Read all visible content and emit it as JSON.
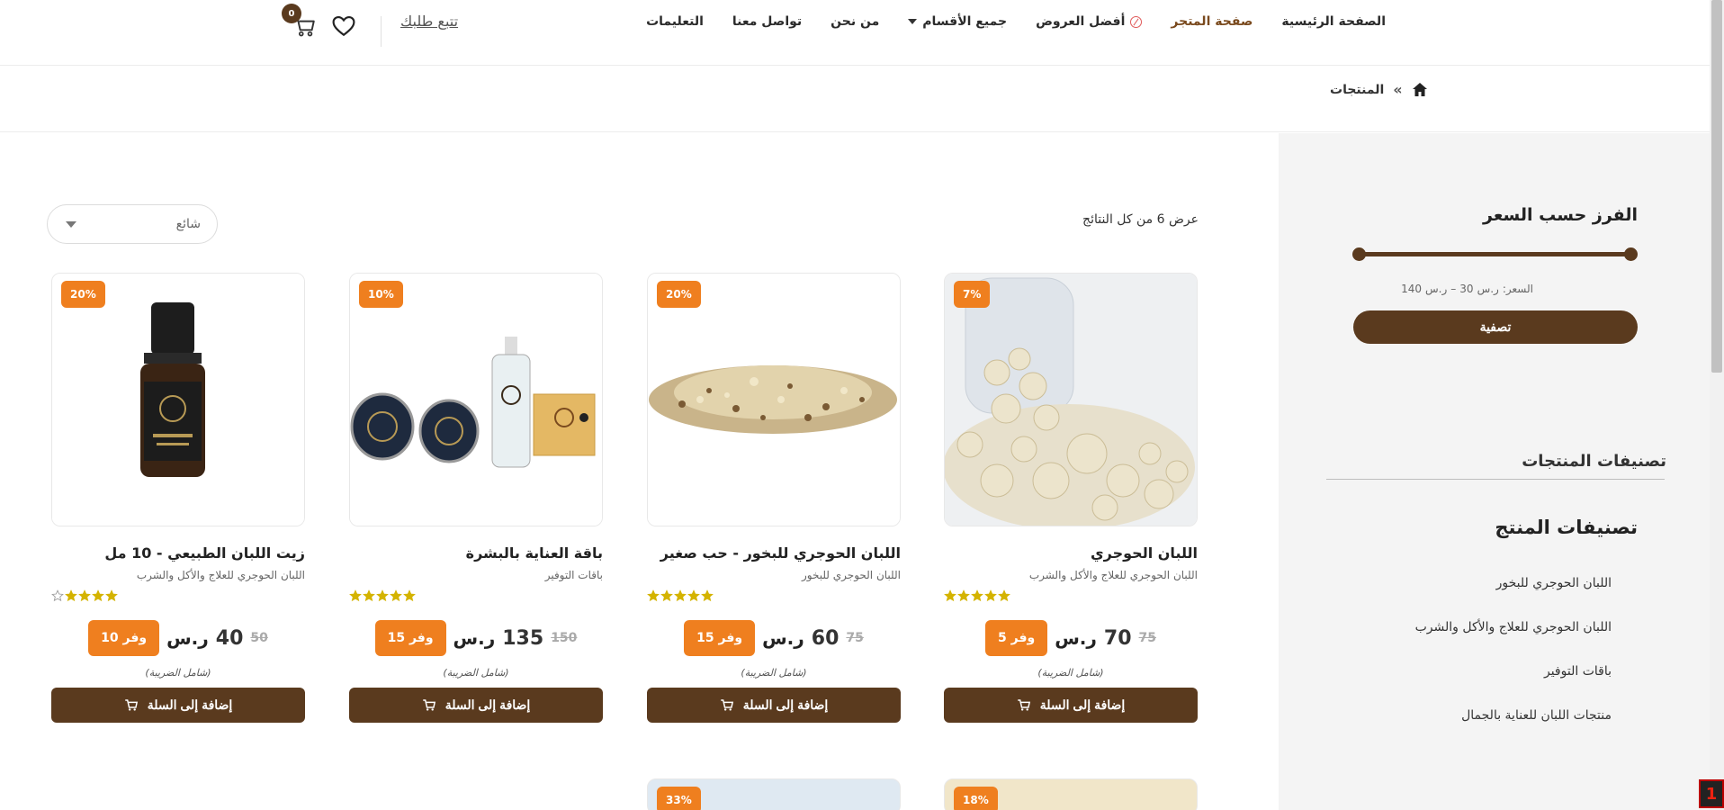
{
  "nav": {
    "items": [
      "الصفحة الرئيسية",
      "صفحة المتجر",
      "أفضل العروض",
      "جميع الأقسام",
      "من نحن",
      "تواصل معنا",
      "التعليمات"
    ],
    "track_order": "تتبع طلبك",
    "cart_count": "0"
  },
  "breadcrumb": {
    "current": "المنتجات"
  },
  "sidebar": {
    "price_filter_title": "الفرز حسب السعر",
    "price_label": "السعر:",
    "price_min": "30",
    "price_max": "140",
    "dash": "–",
    "filter_button": "تصفية",
    "categories_heading": "تصنيفات المنتجات",
    "product_categories_title": "تصنيفات المنتج",
    "categories": [
      "اللبان الحوجري للبخور",
      "اللبان الحوجري للعلاج والأكل والشرب",
      "باقات التوفير",
      "منتجات اللبان للعناية بالجمال"
    ]
  },
  "main": {
    "results_text": "عرض 6 من كل النتائج",
    "sort_value": "شائع",
    "tax_note": "(شامل الضريبة)",
    "add_to_cart": "إضافة إلى السلة",
    "currency_symbol": "ر.س",
    "products": [
      {
        "name": "اللبان الحوجري",
        "category": "اللبان الحوجري للعلاج والأكل والشرب",
        "discount": "7%",
        "old_price": "75",
        "price": "70",
        "save_label": "وفر 5",
        "rating": 5
      },
      {
        "name": "اللبان الحوجري للبخور - حب صغير",
        "category": "اللبان الحوجري للبخور",
        "discount": "20%",
        "old_price": "75",
        "price": "60",
        "save_label": "وفر 15",
        "rating": 5
      },
      {
        "name": "باقة العناية بالبشرة",
        "category": "باقات التوفير",
        "discount": "10%",
        "old_price": "150",
        "price": "135",
        "save_label": "وفر 15",
        "rating": 5
      },
      {
        "name": "زيت اللبان الطبيعي - 10 مل",
        "category": "اللبان الحوجري للعلاج والأكل والشرب",
        "discount": "20%",
        "old_price": "50",
        "price": "40",
        "save_label": "وفر 10",
        "rating": 4
      }
    ],
    "next_row_badges": [
      "18%",
      "33%"
    ]
  },
  "colors": {
    "brown": "#5a3a1e",
    "orange": "#ef7f1f",
    "star": "#d4b300"
  },
  "corner_label": "1"
}
